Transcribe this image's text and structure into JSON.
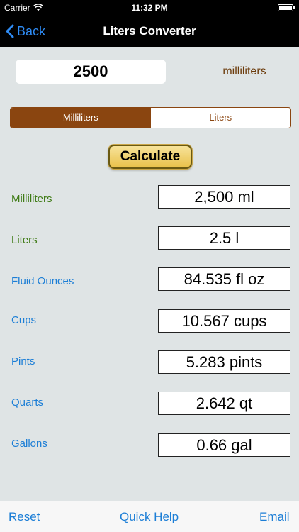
{
  "status_bar": {
    "carrier": "Carrier",
    "time": "11:32 PM"
  },
  "nav": {
    "back_label": "Back",
    "title": "Liters Converter"
  },
  "input": {
    "value": "2500",
    "unit": "milliliters"
  },
  "segments": [
    {
      "label": "Milliliters",
      "selected": true
    },
    {
      "label": "Liters",
      "selected": false
    }
  ],
  "calculate_label": "Calculate",
  "results": [
    {
      "label": "Milliliters",
      "value": "2,500 ml",
      "color": "green"
    },
    {
      "label": "Liters",
      "value": "2.5 l",
      "color": "green"
    },
    {
      "label": "Fluid Ounces",
      "value": "84.535 fl oz",
      "color": "blue"
    },
    {
      "label": "Cups",
      "value": "10.567 cups",
      "color": "blue"
    },
    {
      "label": "Pints",
      "value": "5.283 pints",
      "color": "blue"
    },
    {
      "label": "Quarts",
      "value": "2.642 qt",
      "color": "blue"
    },
    {
      "label": "Gallons",
      "value": "0.66 gal",
      "color": "blue"
    }
  ],
  "toolbar": {
    "reset_label": "Reset",
    "help_label": "Quick Help",
    "email_label": "Email"
  },
  "colors": {
    "accent_brown": "#8a4510",
    "link_blue": "#1c7ed6",
    "label_green": "#3f7b16"
  }
}
